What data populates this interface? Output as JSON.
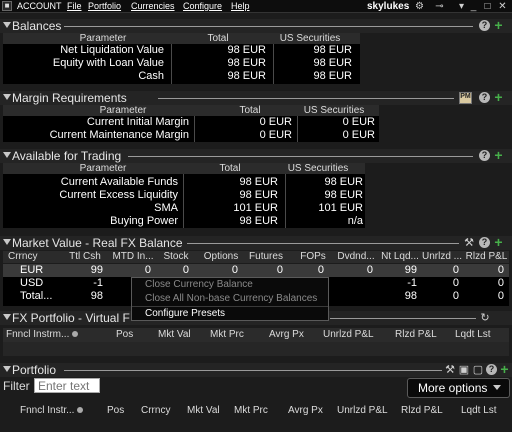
{
  "topbar": {
    "app_label": "ACCOUNT",
    "menus": [
      "File",
      "Portfolio",
      "Currencies",
      "Configure",
      "Help"
    ],
    "user": "skylukes"
  },
  "balances": {
    "title": "Balances",
    "headers": [
      "Parameter",
      "Total",
      "US Securities"
    ],
    "rows": [
      {
        "label": "Net Liquidation Value",
        "total": "98 EUR",
        "us": "98 EUR"
      },
      {
        "label": "Equity with Loan Value",
        "total": "98 EUR",
        "us": "98 EUR"
      },
      {
        "label": "Cash",
        "total": "98 EUR",
        "us": "98 EUR"
      }
    ]
  },
  "margin": {
    "title": "Margin Requirements",
    "headers": [
      "Parameter",
      "Total",
      "US Securities"
    ],
    "rows": [
      {
        "label": "Current Initial Margin",
        "total": "0 EUR",
        "us": "0 EUR"
      },
      {
        "label": "Current Maintenance Margin",
        "total": "0 EUR",
        "us": "0 EUR"
      }
    ],
    "badge_text": "PM"
  },
  "trading": {
    "title": "Available for Trading",
    "headers": [
      "Parameter",
      "Total",
      "US Securities"
    ],
    "rows": [
      {
        "label": "Current Available Funds",
        "total": "98 EUR",
        "us": "98 EUR"
      },
      {
        "label": "Current Excess Liquidity",
        "total": "98 EUR",
        "us": "98 EUR"
      },
      {
        "label": "SMA",
        "total": "101 EUR",
        "us": "101 EUR"
      },
      {
        "label": "Buying Power",
        "total": "98 EUR",
        "us": "n/a"
      }
    ]
  },
  "market_value": {
    "title": "Market Value - Real FX Balance",
    "headers": [
      "Crrncy",
      "Ttl Csh",
      "MTD In...",
      "Stock",
      "Options",
      "Futures",
      "FOPs",
      "Dvdnd...",
      "Nt Lqd...",
      "Unrlzd ...",
      "Rlzd P&L"
    ],
    "rows": [
      {
        "cur": "EUR",
        "ttl": "99",
        "mtd": "0",
        "stock": "0",
        "options": "0",
        "futures": "0",
        "fops": "0",
        "dvd": "0",
        "nt": "99",
        "unr": "0",
        "rlz": "0"
      },
      {
        "cur": "USD",
        "ttl": "-1",
        "mtd": "",
        "stock": "",
        "options": "",
        "futures": "",
        "fops": "",
        "dvd": "",
        "nt": "-1",
        "unr": "0",
        "rlz": "0"
      },
      {
        "cur": "Total...",
        "ttl": "98",
        "mtd": "",
        "stock": "",
        "options": "",
        "futures": "",
        "fops": "",
        "dvd": "",
        "nt": "98",
        "unr": "0",
        "rlz": "0"
      }
    ]
  },
  "context_menu": {
    "items": [
      {
        "label": "Close Currency Balance",
        "enabled": false
      },
      {
        "label": "Close All Non-base Currency Balances",
        "enabled": false
      },
      {
        "label": "Configure Presets",
        "enabled": true
      }
    ]
  },
  "fx_portfolio": {
    "title": "FX Portfolio - Virtual F",
    "headers": [
      "Fnncl Instrm...",
      "Pos",
      "Mkt Val",
      "Mkt Prc",
      "Avrg Px",
      "Unrlzd P&L",
      "Rlzd P&L",
      "Lqdt Lst"
    ]
  },
  "portfolio": {
    "title": "Portfolio",
    "filter_label": "Filter",
    "filter_placeholder": "Enter text",
    "more_options": "More options",
    "headers": [
      "Fnncl Instr...",
      "Pos",
      "Crrncy",
      "Mkt Val",
      "Mkt Prc",
      "Avrg Px",
      "Unrlzd P&L",
      "Rlzd P&L",
      "Lqdt Lst"
    ]
  },
  "colors": {
    "background": "#1c1c1c",
    "data_area": "#000000",
    "accent_plus": "#47b04a"
  }
}
